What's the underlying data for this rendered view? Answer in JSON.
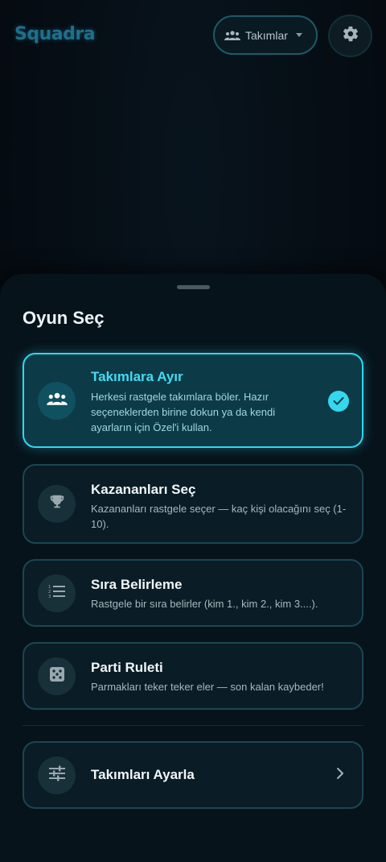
{
  "app": {
    "name": "Squadra"
  },
  "header": {
    "mode_label": "Takımlar",
    "mode_icon": "group-icon",
    "settings_icon": "gear-icon"
  },
  "sheet": {
    "title": "Oyun Seç",
    "options": [
      {
        "title": "Takımlara Ayır",
        "description": "Herkesi rastgele takımlara böler. Hazır seçeneklerden birine dokun ya da kendi ayarların için Özel'i kullan.",
        "icon": "group-icon",
        "selected": true
      },
      {
        "title": "Kazananları Seç",
        "description": "Kazananları rastgele seçer — kaç kişi olacağını seç (1-10).",
        "icon": "trophy-icon",
        "selected": false
      },
      {
        "title": "Sıra Belirleme",
        "description": "Rastgele bir sıra belirler (kim 1., kim 2., kim 3....).",
        "icon": "numbered-list-icon",
        "selected": false
      },
      {
        "title": "Parti Ruleti",
        "description": "Parmakları teker teker eler — son kalan kaybeder!",
        "icon": "dice-icon",
        "selected": false
      }
    ],
    "settings_item": {
      "title": "Takımları Ayarla",
      "icon": "tune-icon"
    }
  },
  "colors": {
    "accent": "#2fd8f0",
    "background": "#050d14",
    "card": "#0a1c25",
    "card_border": "#1a4652"
  }
}
